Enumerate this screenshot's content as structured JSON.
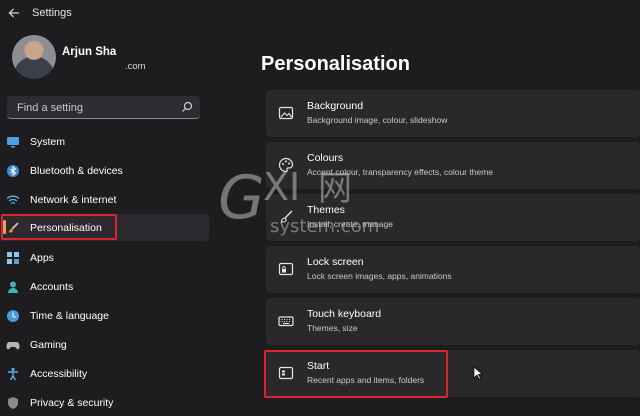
{
  "window": {
    "title": "Settings"
  },
  "user": {
    "name": "Arjun Sha",
    "email": ".com"
  },
  "search": {
    "placeholder": "Find a setting"
  },
  "nav": {
    "items": [
      {
        "label": "System",
        "icon": "monitor-icon"
      },
      {
        "label": "Bluetooth & devices",
        "icon": "bluetooth-icon"
      },
      {
        "label": "Network & internet",
        "icon": "wifi-icon"
      },
      {
        "label": "Personalisation",
        "icon": "brush-icon",
        "selected": true
      },
      {
        "label": "Apps",
        "icon": "apps-grid-icon"
      },
      {
        "label": "Accounts",
        "icon": "person-icon"
      },
      {
        "label": "Time & language",
        "icon": "globe-clock-icon"
      },
      {
        "label": "Gaming",
        "icon": "gamepad-icon"
      },
      {
        "label": "Accessibility",
        "icon": "accessibility-icon"
      },
      {
        "label": "Privacy & security",
        "icon": "shield-icon"
      }
    ]
  },
  "main": {
    "title": "Personalisation",
    "cards": [
      {
        "title": "Background",
        "subtitle": "Background image, colour, slideshow",
        "icon": "image-icon"
      },
      {
        "title": "Colours",
        "subtitle": "Accent colour, transparency effects, colour theme",
        "icon": "palette-icon"
      },
      {
        "title": "Themes",
        "subtitle": "Install, create, manage",
        "icon": "brush-icon"
      },
      {
        "title": "Lock screen",
        "subtitle": "Lock screen images, apps, animations",
        "icon": "lock-screen-icon"
      },
      {
        "title": "Touch keyboard",
        "subtitle": "Themes, size",
        "icon": "keyboard-icon"
      },
      {
        "title": "Start",
        "subtitle": "Recent apps and items, folders",
        "icon": "start-menu-icon"
      }
    ]
  },
  "watermark": {
    "brand": "GXI网",
    "domain": "system.com"
  },
  "colors": {
    "background": "#1f1c20",
    "card": "#2b282c",
    "highlight": "#d9252f",
    "accent": "#e0a75a"
  }
}
